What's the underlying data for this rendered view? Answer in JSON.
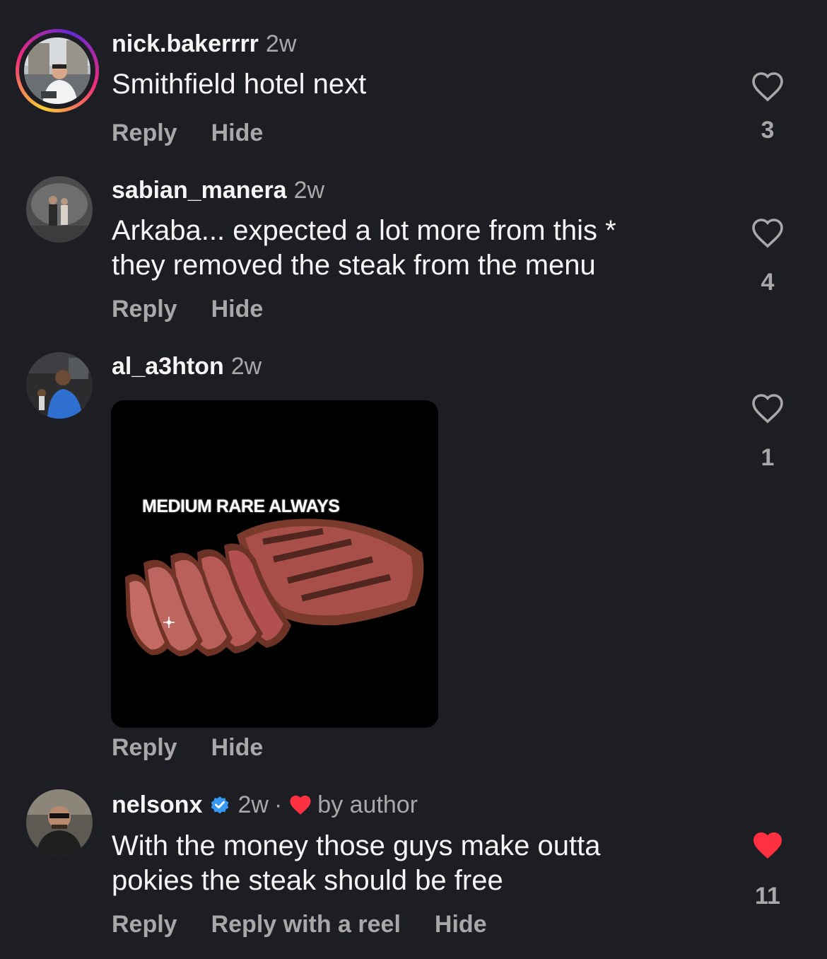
{
  "comments": [
    {
      "username": "nick.bakerrrr",
      "time": "2w",
      "text_lines": [
        "Smithfield hotel next"
      ],
      "actions": [
        "Reply",
        "Hide"
      ],
      "likes": "3",
      "liked": false,
      "has_story_ring": true
    },
    {
      "username": "sabian_manera",
      "time": "2w",
      "text_lines": [
        "Arkaba... expected a lot more from this *",
        "they removed the steak from the menu"
      ],
      "actions": [
        "Reply",
        "Hide"
      ],
      "likes": "4",
      "liked": false
    },
    {
      "username": "al_a3hton",
      "time": "2w",
      "image_caption": "MEDIUM RARE ALWAYS",
      "actions": [
        "Reply",
        "Hide"
      ],
      "likes": "1",
      "liked": false
    },
    {
      "username": "nelsonx",
      "verified": true,
      "time": "2w",
      "separator": "·",
      "author_like_label": "by author",
      "text_lines": [
        "With the money those guys make outta",
        "pokies the steak should be free"
      ],
      "actions": [
        "Reply",
        "Reply with a reel",
        "Hide"
      ],
      "likes": "11",
      "liked": true
    }
  ],
  "colors": {
    "background": "#1c1e23",
    "primary_text": "#f5f5f5",
    "secondary_text": "#a8a8a8",
    "like_red": "#ff3040",
    "verified_blue": "#3897f0"
  },
  "icons": {
    "heart_outline": "heart-outline-icon",
    "heart_filled": "heart-filled-icon",
    "verified": "verified-badge-icon"
  }
}
